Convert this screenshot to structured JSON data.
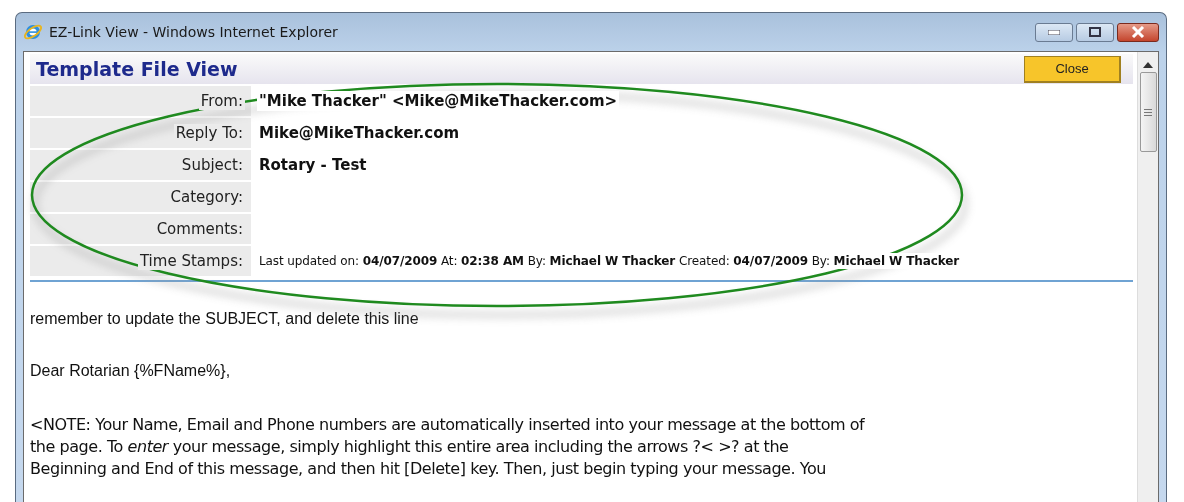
{
  "window": {
    "title": "EZ-Link View - Windows Internet Explorer"
  },
  "header": {
    "title": "Template File View",
    "close_button": "Close"
  },
  "fields": [
    {
      "label": "From:",
      "kind": "bold",
      "value": "\"Mike Thacker\" <Mike@MikeThacker.com>"
    },
    {
      "label": "Reply To:",
      "kind": "bold",
      "value": "Mike@MikeThacker.com"
    },
    {
      "label": "Subject:",
      "kind": "bold",
      "value": "Rotary - Test"
    },
    {
      "label": "Category:"
    },
    {
      "label": "Comments:"
    },
    {
      "label": "Time Stamps:",
      "kind": "stamps",
      "value": "Last updated on: **04/07/2009** At: **02:38 AM** By: **Michael W Thacker**  Created: **04/07/2009** By: **Michael W Thacker**"
    }
  ],
  "body": [
    {
      "kind": "line",
      "text": "remember to update the SUBJECT, and delete this line"
    },
    {
      "kind": "line",
      "text": "Dear Rotarian {%FName%},"
    },
    {
      "kind": "note",
      "lines": [
        "<NOTE: Your Name, Email and Phone numbers are automatically inserted into your message at the bottom of",
        "the page.  To *enter* your message, simply highlight this entire area including the arrows ?< >? at the",
        "Beginning and End of this message, and then hit  [Delete] key.  Then, just begin typing your message.  You"
      ]
    }
  ]
}
